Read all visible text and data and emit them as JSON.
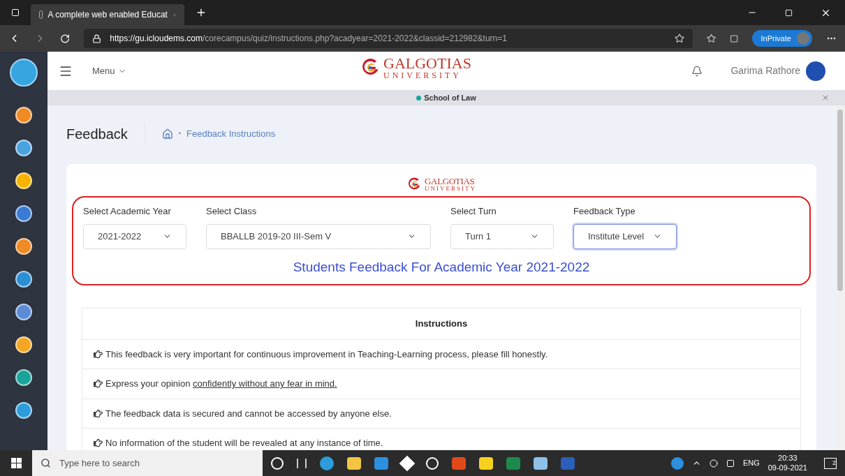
{
  "browser": {
    "tab_title": "A complete web enabled Educat",
    "url_host": "https://gu.icloudems.com",
    "url_path": "/corecampus/quiz/instructions.php?acadyear=2021-2022&classid=212982&turn=1",
    "inprivate": "InPrivate"
  },
  "header": {
    "menu": "Menu",
    "logo_name": "GALGOTIAS",
    "logo_sub": "UNIVERSITY",
    "user": "Garima Rathore"
  },
  "school_bar": {
    "label": "School of Law"
  },
  "page": {
    "title": "Feedback",
    "separator": "•",
    "breadcrumb": "Feedback Instructions"
  },
  "card": {
    "logo_name": "GALGOTIAS",
    "logo_sub": "UNIVERSITY",
    "filters": [
      {
        "label": "Select Academic Year",
        "value": "2021-2022",
        "kind": "narrow",
        "focused": false
      },
      {
        "label": "Select Class",
        "value": "BBALLB 2019-20 III-Sem V",
        "kind": "wide",
        "focused": false
      },
      {
        "label": "Select Turn",
        "value": "Turn 1",
        "kind": "narrow",
        "focused": false
      },
      {
        "label": "Feedback Type",
        "value": "Institute Level",
        "kind": "narrow",
        "focused": true
      }
    ],
    "heading": "Students Feedback For Academic Year 2021-2022"
  },
  "instructions": {
    "title": "Instructions",
    "items": [
      {
        "text": "This feedback is very important for continuous improvement in Teaching-Learning process, please fill honestly."
      },
      {
        "text": "Express your opinion ",
        "link": "confidently without any fear in mind."
      },
      {
        "text": "The feedback data is secured and cannot be accessed by anyone else."
      },
      {
        "text": "No information of the student will be revealed at any instance of time."
      }
    ]
  },
  "taskbar": {
    "search_placeholder": "Type here to search",
    "language": "ENG",
    "time": "20:33",
    "date": "09-09-2021",
    "notifications": "2"
  }
}
